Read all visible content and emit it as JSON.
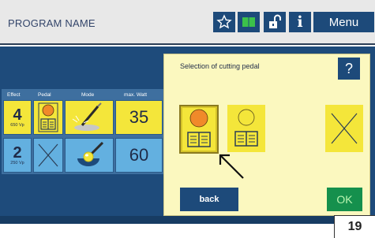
{
  "header": {
    "program_name": "PROGRAM NAME",
    "menu_label": "Menu",
    "info_label": "i",
    "icons": [
      "star-icon",
      "book-icon",
      "unlock-icon",
      "info-icon"
    ]
  },
  "table": {
    "headers": [
      "Effect",
      "Pedal",
      "Mode",
      "max. Watt"
    ],
    "rows": [
      {
        "effect": "4",
        "effect_sub": "650 Vp",
        "pedal": "pedal-icon",
        "mode": "cutting-instrument-icon",
        "watt": "35"
      },
      {
        "effect": "2",
        "effect_sub": "250 Vp",
        "pedal": "none",
        "mode": "coagulation-instrument-icon",
        "watt": "60"
      }
    ]
  },
  "dialog": {
    "title": "Selection of cutting pedal",
    "help_label": "?",
    "options": [
      {
        "name": "pedal-orange",
        "selected": true
      },
      {
        "name": "pedal-blank",
        "selected": false
      },
      {
        "name": "no-pedal",
        "selected": false
      }
    ],
    "back_label": "back",
    "ok_label": "OK"
  },
  "figure_label": "19",
  "colors": {
    "header_bg": "#e8e8e8",
    "dark_blue": "#1e4b7b",
    "yellow": "#f4e63a",
    "light_blue": "#63b0e0",
    "dialog_bg": "#fbf8bf",
    "ok_green": "#15904d",
    "orange": "#f08a2a"
  }
}
